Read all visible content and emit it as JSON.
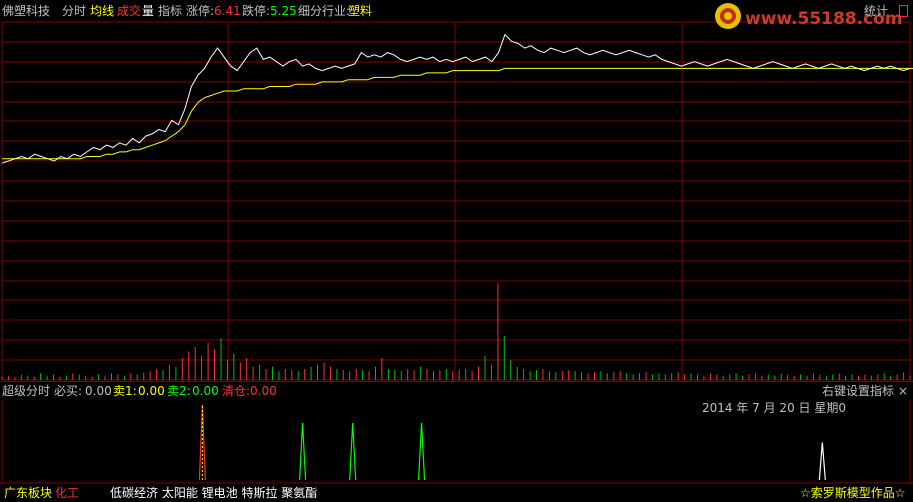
{
  "header": {
    "stock_name": "佛塑科技",
    "tab_fenshi": "分时",
    "tab_junxian": "均线",
    "tab_chengjiaoliang_a": "成交",
    "tab_chengjiaoliang_b": "量",
    "tab_zhibiao": "指标",
    "zhangting_label": "涨停:",
    "zhangting_value": "6.41",
    "dieting_label": "跌停:",
    "dieting_value": "5.25",
    "industry_label": "细分行业:",
    "industry_value": "塑料",
    "stats_label": "统计",
    "watermark": "www.55188.com"
  },
  "indicator": {
    "name": "超级分时",
    "bisai_label": "必买:",
    "bisai_value": "0.00",
    "mai1_label": "卖1:",
    "mai1_value": "0.00",
    "mai2_label": "卖2:",
    "mai2_value": "0.00",
    "qingcang_label": "清仓:",
    "qingcang_value": "0.00",
    "right_click_hint": "右键设置指标",
    "close_symbol": "×",
    "date_text": "2014 年 7 月 20 日 星期0"
  },
  "bottom": {
    "region": "广东板块",
    "sector": "化工",
    "concepts": "低碳经济 太阳能 锂电池 特斯拉 聚氨酯",
    "author": "☆索罗斯模型作品☆"
  },
  "colors": {
    "grid": "#800000",
    "price_line": "#ffffff",
    "avg_line": "#ffff00",
    "up_volume": "#ff3030",
    "down_volume": "#00c000",
    "limit_up": "#ff3030",
    "limit_down": "#00ff00",
    "industry": "#ffff00"
  },
  "chart_data": {
    "type": "line",
    "series": [
      {
        "values": [
          5.71,
          5.72,
          5.73,
          5.74,
          5.73,
          5.75,
          5.74,
          5.73,
          5.72,
          5.74,
          5.73,
          5.75,
          5.74,
          5.76,
          5.78,
          5.77,
          5.79,
          5.78,
          5.8,
          5.79,
          5.82,
          5.8,
          5.83,
          5.84,
          5.86,
          5.85,
          5.9,
          5.88,
          5.95,
          6.05,
          6.1,
          6.13,
          6.18,
          6.22,
          6.18,
          6.14,
          6.12,
          6.16,
          6.2,
          6.22,
          6.17,
          6.18,
          6.16,
          6.14,
          6.16,
          6.17,
          6.14,
          6.15,
          6.13,
          6.12,
          6.13,
          6.14,
          6.13,
          6.14,
          6.15,
          6.2,
          6.18,
          6.19,
          6.18,
          6.2,
          6.19,
          6.17,
          6.16,
          6.17,
          6.18,
          6.17,
          6.18,
          6.16,
          6.17,
          6.16,
          6.17,
          6.18,
          6.16,
          6.17,
          6.18,
          6.16,
          6.2,
          6.28,
          6.25,
          6.24,
          6.22,
          6.23,
          6.21,
          6.2,
          6.22,
          6.21,
          6.2,
          6.21,
          6.22,
          6.2,
          6.19,
          6.2,
          6.21,
          6.2,
          6.19,
          6.2,
          6.21,
          6.2,
          6.19,
          6.18,
          6.19,
          6.17,
          6.16,
          6.15,
          6.14,
          6.15,
          6.16,
          6.15,
          6.14,
          6.15,
          6.16,
          6.17,
          6.16,
          6.15,
          6.14,
          6.13,
          6.14,
          6.15,
          6.16,
          6.15,
          6.14,
          6.13,
          6.14,
          6.15,
          6.14,
          6.13,
          6.14,
          6.15,
          6.14,
          6.13,
          6.14,
          6.13,
          6.12,
          6.13,
          6.14,
          6.13,
          6.14,
          6.13,
          6.12,
          6.13
        ]
      },
      {
        "values": [
          5.73,
          5.73,
          5.73,
          5.73,
          5.73,
          5.73,
          5.73,
          5.73,
          5.73,
          5.73,
          5.73,
          5.73,
          5.73,
          5.74,
          5.74,
          5.74,
          5.75,
          5.75,
          5.76,
          5.76,
          5.77,
          5.77,
          5.78,
          5.79,
          5.8,
          5.81,
          5.83,
          5.85,
          5.88,
          5.94,
          5.98,
          6.0,
          6.01,
          6.02,
          6.03,
          6.03,
          6.03,
          6.04,
          6.04,
          6.04,
          6.04,
          6.05,
          6.05,
          6.05,
          6.05,
          6.06,
          6.06,
          6.06,
          6.06,
          6.07,
          6.07,
          6.07,
          6.07,
          6.08,
          6.08,
          6.08,
          6.08,
          6.09,
          6.09,
          6.09,
          6.09,
          6.1,
          6.1,
          6.1,
          6.1,
          6.11,
          6.11,
          6.11,
          6.11,
          6.12,
          6.12,
          6.12,
          6.12,
          6.12,
          6.12,
          6.12,
          6.12,
          6.13,
          6.13,
          6.13,
          6.13,
          6.13,
          6.13,
          6.13,
          6.13,
          6.13,
          6.13,
          6.13,
          6.13,
          6.13,
          6.13,
          6.13,
          6.13,
          6.13,
          6.13,
          6.13,
          6.13,
          6.13,
          6.13,
          6.13,
          6.13,
          6.13,
          6.13,
          6.13,
          6.13,
          6.13,
          6.13,
          6.13,
          6.13,
          6.13,
          6.13,
          6.13,
          6.13,
          6.13,
          6.13,
          6.13,
          6.13,
          6.13,
          6.13,
          6.13,
          6.13,
          6.13,
          6.13,
          6.13,
          6.13,
          6.13,
          6.13,
          6.13,
          6.13,
          6.13,
          6.13,
          6.13,
          6.13,
          6.13,
          6.13,
          6.13,
          6.13,
          6.13,
          6.13,
          6.13,
          6.13,
          6.13
        ]
      }
    ],
    "ylim": [
      5.25,
      6.41
    ],
    "volume": {
      "values": [
        3,
        4,
        3,
        5,
        4,
        3,
        6,
        4,
        5,
        3,
        4,
        6,
        5,
        4,
        3,
        5,
        4,
        6,
        5,
        4,
        6,
        5,
        7,
        8,
        10,
        9,
        14,
        12,
        20,
        26,
        30,
        22,
        34,
        28,
        38,
        18,
        24,
        16,
        20,
        12,
        14,
        10,
        12,
        8,
        10,
        9,
        8,
        10,
        12,
        14,
        16,
        12,
        10,
        9,
        8,
        10,
        9,
        8,
        12,
        20,
        10,
        9,
        8,
        10,
        9,
        12,
        10,
        8,
        9,
        10,
        8,
        9,
        10,
        8,
        12,
        22,
        14,
        88,
        40,
        18,
        12,
        10,
        8,
        9,
        10,
        8,
        7,
        8,
        9,
        8,
        7,
        6,
        7,
        8,
        6,
        7,
        8,
        6,
        5,
        6,
        7,
        5,
        6,
        5,
        6,
        7,
        5,
        6,
        5,
        4,
        6,
        5,
        4,
        5,
        6,
        4,
        5,
        6,
        4,
        5,
        4,
        6,
        5,
        4,
        5,
        4,
        6,
        5,
        4,
        5,
        6,
        4,
        5,
        4,
        5,
        4,
        5,
        6,
        4,
        5,
        7,
        4
      ],
      "ylim": [
        0,
        100
      ]
    },
    "signals": {
      "values": [
        0,
        0,
        0,
        0,
        0,
        0,
        0,
        0,
        0,
        0,
        0,
        0,
        0,
        0,
        0,
        0,
        0,
        0,
        0,
        0,
        0,
        0,
        0,
        0,
        0,
        0,
        0,
        0,
        0,
        0,
        0,
        0,
        0,
        0,
        0,
        0,
        0,
        0,
        0,
        0,
        0,
        0,
        0,
        0,
        0,
        0,
        0,
        0,
        0,
        0,
        0,
        0,
        0,
        0,
        0,
        0,
        0,
        0,
        0,
        0,
        0,
        0,
        0,
        0,
        0,
        0,
        0,
        0,
        0,
        0,
        0,
        0,
        0,
        0,
        0,
        0,
        0,
        0,
        0,
        0,
        0,
        0,
        0,
        0,
        0,
        0,
        0,
        0,
        0,
        0,
        0,
        0,
        0,
        0,
        0,
        0,
        0,
        0,
        0,
        0,
        0,
        0,
        0,
        0,
        0,
        0,
        0,
        0,
        0,
        0,
        0,
        0,
        0,
        0,
        0,
        0,
        0,
        0,
        0,
        0,
        0,
        0,
        0,
        0,
        0,
        0,
        0,
        0,
        0,
        0,
        0,
        0,
        0,
        0,
        0,
        0,
        0,
        0,
        0,
        0,
        0,
        0,
        0,
        0,
        0,
        0
      ],
      "marks": [
        {
          "index": 32,
          "height": 1.0,
          "kind": "buy"
        },
        {
          "index": 48,
          "height": 0.76,
          "kind": "sell1"
        },
        {
          "index": 56,
          "height": 0.76,
          "kind": "sell1"
        },
        {
          "index": 67,
          "height": 0.76,
          "kind": "sell1"
        },
        {
          "index": 131,
          "height": 0.5,
          "kind": "clear"
        }
      ]
    }
  }
}
